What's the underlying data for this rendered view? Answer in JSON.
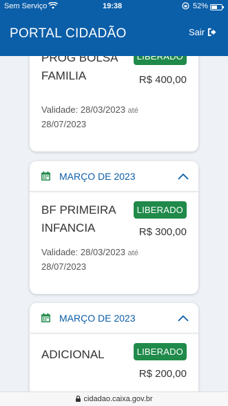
{
  "status": {
    "carrier": "Sem Serviço",
    "time": "19:38",
    "battery": "52%"
  },
  "header": {
    "title": "PORTAL CIDADÃO",
    "logout_label": "Sair"
  },
  "cards": [
    {
      "benefit": "PROG BOLSA FAMILIA",
      "badge": "LIBERADO",
      "value": "R$ 400,00",
      "validity_prefix": "Validade: 28/03/2023",
      "validity_ate": "até",
      "validity_end": "28/07/2023"
    },
    {
      "month": "MARÇO DE 2023",
      "benefit": "BF PRIMEIRA INFANCIA",
      "badge": "LIBERADO",
      "value": "R$ 300,00",
      "validity_prefix": "Validade: 28/03/2023",
      "validity_ate": "até",
      "validity_end": "28/07/2023"
    },
    {
      "month": "MARÇO DE 2023",
      "benefit": "ADICIONAL",
      "badge": "LIBERADO",
      "value": "R$ 200,00"
    }
  ],
  "browser": {
    "url": "cidadao.caixa.gov.br"
  }
}
